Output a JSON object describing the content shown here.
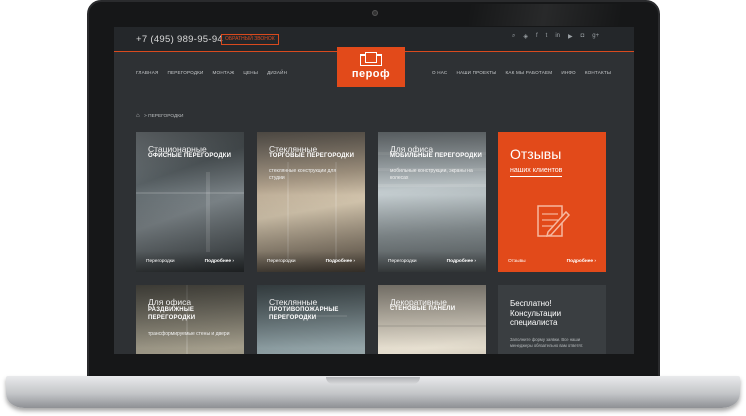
{
  "header": {
    "phone": "+7 (495) 989-95-94",
    "callback_label": "ОБРАТНЫЙ ЗВОНОК",
    "top_icons": [
      "search-icon",
      "vk-icon",
      "facebook-icon",
      "twitter-icon",
      "linkedin-icon",
      "youtube-icon",
      "instagram-icon",
      "googleplus-icon"
    ]
  },
  "nav": {
    "left": [
      "ГЛАВНАЯ",
      "ПЕРЕГОРОДКИ",
      "МОНТАЖ",
      "ЦЕНЫ",
      "ДИЗАЙН"
    ],
    "right": [
      "О НАС",
      "НАШИ ПРОЕКТЫ",
      "КАК МЫ РАБОТАЕМ",
      "ИНФО",
      "КОНТАКТЫ"
    ]
  },
  "logo": {
    "text": "пероф"
  },
  "breadcrumb": {
    "home_icon": "⌂",
    "separator": ">",
    "current": "ПЕРЕГОРОДКИ"
  },
  "cards": [
    {
      "pre": "Стационарные",
      "title": "ОФИСНЫЕ ПЕРЕГОРОДКИ",
      "desc": "",
      "link": "Перегородки",
      "more": "Подробнее ›"
    },
    {
      "pre": "Стеклянные",
      "title": "ТОРГОВЫЕ ПЕРЕГОРОДКИ",
      "desc": "стеклянные конструкции для студии",
      "link": "Перегородки",
      "more": "Подробнее ›"
    },
    {
      "pre": "Для офиса",
      "title": "МОБИЛЬНЫЕ ПЕРЕГОРОДКИ",
      "desc": "мобильные конструкции, экраны на колесах",
      "link": "Перегородки",
      "more": "Подробнее ›"
    },
    {
      "pre": "Для офиса",
      "title": "РАЗДВИЖНЫЕ ПЕРЕГОРОДКИ",
      "desc": "трансформируемые стены и двери",
      "link": "",
      "more": ""
    },
    {
      "pre": "Стеклянные",
      "title": "ПРОТИВОПОЖАРНЫЕ ПЕРЕГОРОДКИ",
      "desc": "",
      "link": "",
      "more": ""
    },
    {
      "pre": "Декоративные",
      "title": "СТЕНОВЫЕ ПАНЕЛИ",
      "desc": "",
      "link": "",
      "more": ""
    }
  ],
  "reviews_card": {
    "title": "Отзывы",
    "subtitle": "наших клиентов",
    "link": "Отзывы",
    "more": "Подробнее ›"
  },
  "consult_card": {
    "title": "Бесплатно! Консультации специалиста",
    "desc": "Заполните форму заявки. Все наши менеджеры обязательно вам ответят."
  }
}
